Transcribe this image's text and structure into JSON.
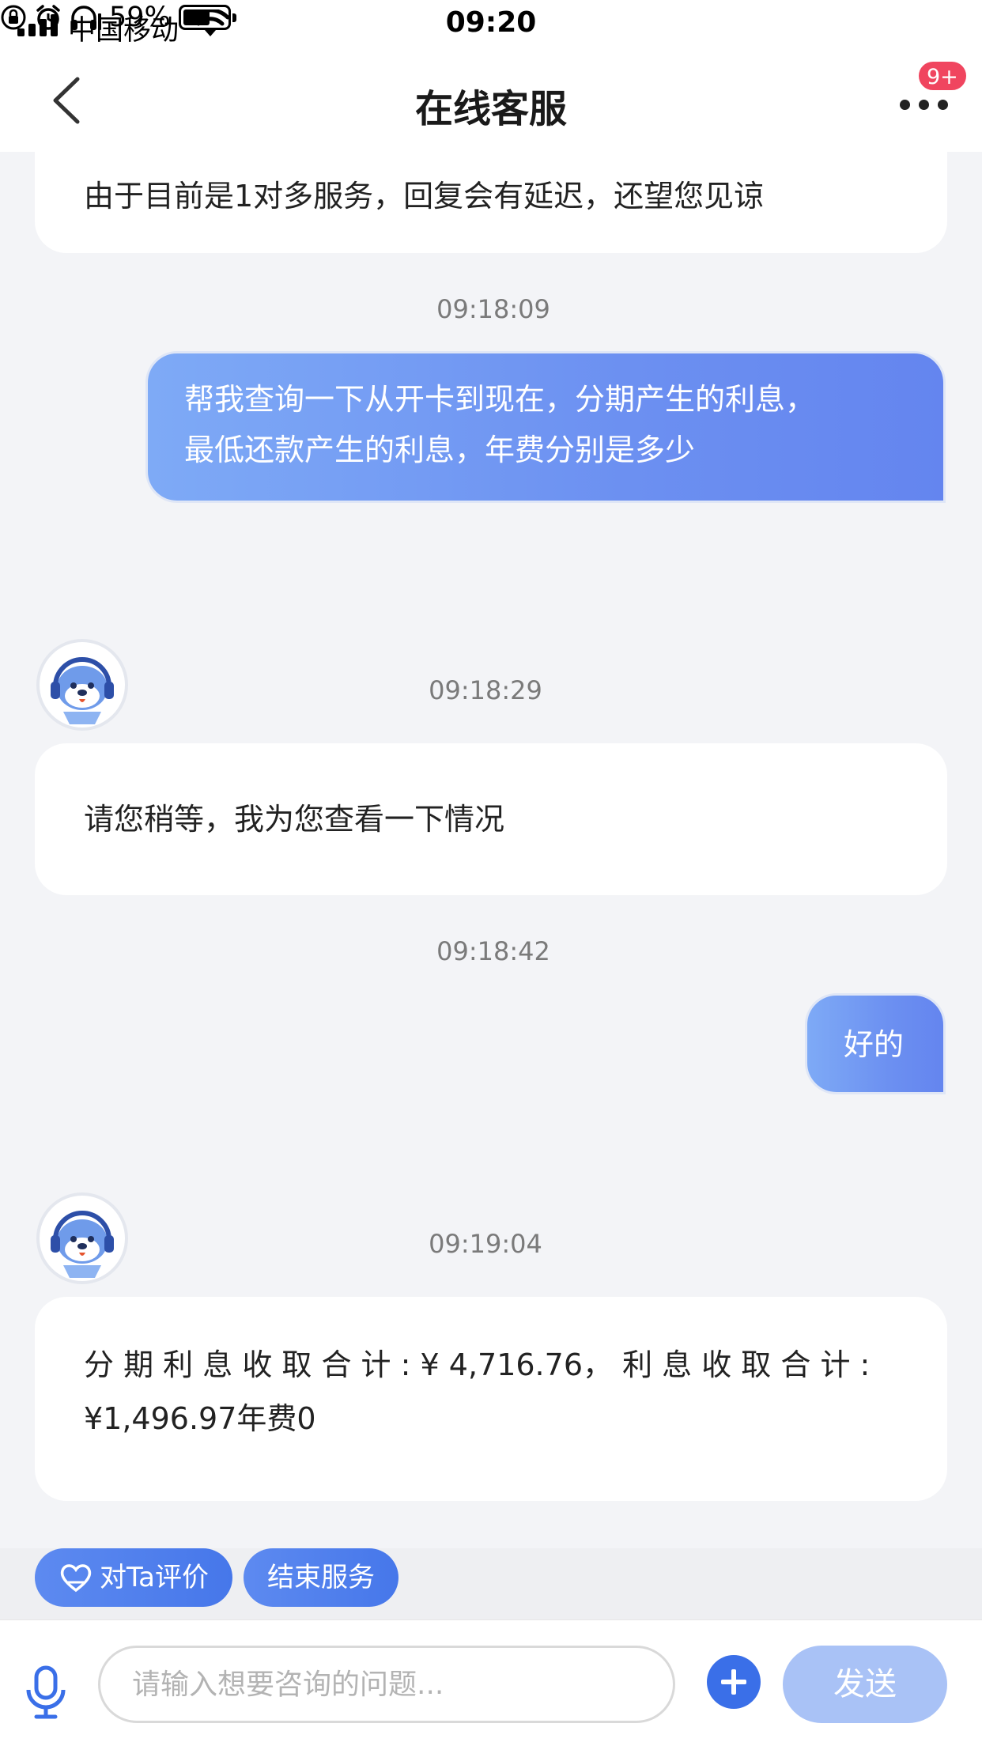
{
  "status_bar": {
    "carrier": "中国移动",
    "time": "09:20",
    "battery_percent": "59%",
    "battery_level": 0.59,
    "icons": [
      "signal-icon",
      "wifi-icon",
      "orientation-lock-icon",
      "alarm-icon",
      "headphones-icon",
      "battery-icon"
    ]
  },
  "nav": {
    "title": "在线客服",
    "badge": "9+",
    "back_icon": "chevron-left-icon",
    "more_icon": "more-dots-icon"
  },
  "messages": [
    {
      "from": "agent",
      "text": "由于目前是1对多服务，回复会有延迟，还望您见谅"
    },
    {
      "from": "user",
      "time": "09:18:09",
      "lines": [
        "帮我查询一下从开卡到现在，分期产生的利息，",
        "最低还款产生的利息，年费分别是多少"
      ]
    },
    {
      "from": "agent",
      "time": "09:18:29",
      "text": "请您稍等，我为您查看一下情况"
    },
    {
      "from": "user",
      "time": "09:18:42",
      "text": "好的"
    },
    {
      "from": "agent",
      "time": "09:19:04",
      "lines": [
        "分 期 利 息 收 取 合 计 : ¥ 4,716.76， 利 息 收 取 合 计 :",
        "¥1,496.97年费0"
      ]
    }
  ],
  "quick_actions": {
    "rate": "对Ta评价",
    "end": "结束服务"
  },
  "input": {
    "placeholder": "请输入想要咨询的问题...",
    "send": "发送"
  },
  "colors": {
    "accent": "#4677ea",
    "user_bubble": "#6c90f1",
    "badge": "#f0455f",
    "send_disabled": "#a9c2f6"
  }
}
